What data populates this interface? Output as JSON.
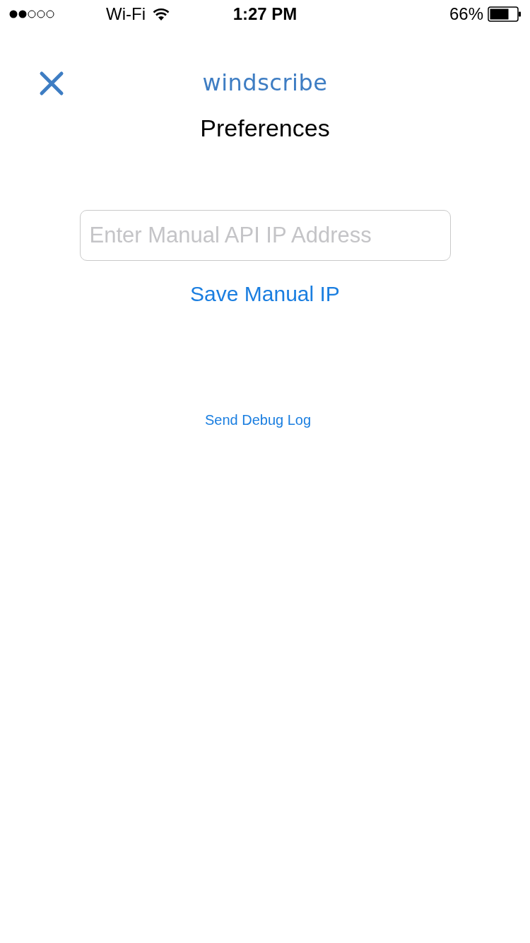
{
  "status_bar": {
    "carrier": "Wi-Fi",
    "time": "1:27 PM",
    "battery": "66%"
  },
  "header": {
    "logo": "windscribe",
    "title": "Preferences"
  },
  "manual_ip": {
    "placeholder": "Enter Manual API IP Address",
    "save_label": "Save Manual IP"
  },
  "debug_link": "Send Debug Log"
}
